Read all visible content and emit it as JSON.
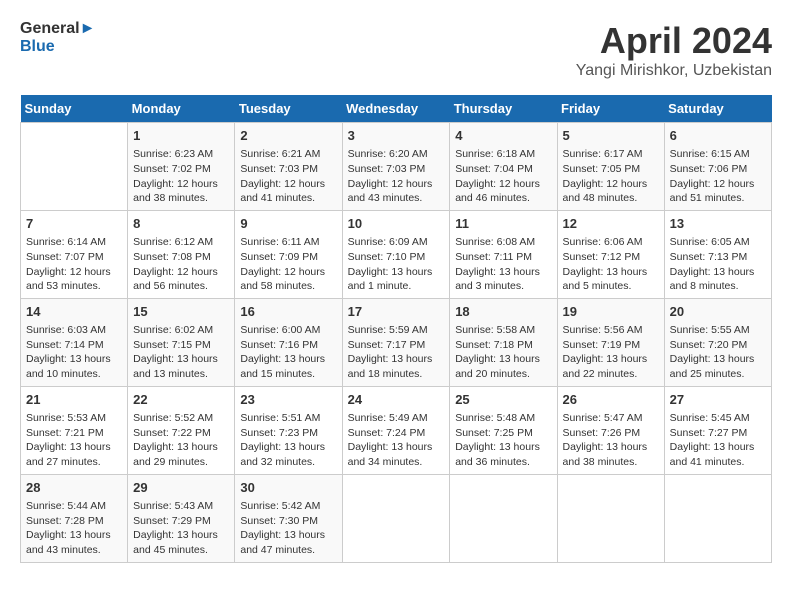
{
  "header": {
    "logo_line1": "General",
    "logo_line2": "Blue",
    "title": "April 2024",
    "subtitle": "Yangi Mirishkor, Uzbekistan"
  },
  "weekdays": [
    "Sunday",
    "Monday",
    "Tuesday",
    "Wednesday",
    "Thursday",
    "Friday",
    "Saturday"
  ],
  "weeks": [
    [
      {
        "day": "",
        "info": ""
      },
      {
        "day": "1",
        "info": "Sunrise: 6:23 AM\nSunset: 7:02 PM\nDaylight: 12 hours\nand 38 minutes."
      },
      {
        "day": "2",
        "info": "Sunrise: 6:21 AM\nSunset: 7:03 PM\nDaylight: 12 hours\nand 41 minutes."
      },
      {
        "day": "3",
        "info": "Sunrise: 6:20 AM\nSunset: 7:03 PM\nDaylight: 12 hours\nand 43 minutes."
      },
      {
        "day": "4",
        "info": "Sunrise: 6:18 AM\nSunset: 7:04 PM\nDaylight: 12 hours\nand 46 minutes."
      },
      {
        "day": "5",
        "info": "Sunrise: 6:17 AM\nSunset: 7:05 PM\nDaylight: 12 hours\nand 48 minutes."
      },
      {
        "day": "6",
        "info": "Sunrise: 6:15 AM\nSunset: 7:06 PM\nDaylight: 12 hours\nand 51 minutes."
      }
    ],
    [
      {
        "day": "7",
        "info": "Sunrise: 6:14 AM\nSunset: 7:07 PM\nDaylight: 12 hours\nand 53 minutes."
      },
      {
        "day": "8",
        "info": "Sunrise: 6:12 AM\nSunset: 7:08 PM\nDaylight: 12 hours\nand 56 minutes."
      },
      {
        "day": "9",
        "info": "Sunrise: 6:11 AM\nSunset: 7:09 PM\nDaylight: 12 hours\nand 58 minutes."
      },
      {
        "day": "10",
        "info": "Sunrise: 6:09 AM\nSunset: 7:10 PM\nDaylight: 13 hours\nand 1 minute."
      },
      {
        "day": "11",
        "info": "Sunrise: 6:08 AM\nSunset: 7:11 PM\nDaylight: 13 hours\nand 3 minutes."
      },
      {
        "day": "12",
        "info": "Sunrise: 6:06 AM\nSunset: 7:12 PM\nDaylight: 13 hours\nand 5 minutes."
      },
      {
        "day": "13",
        "info": "Sunrise: 6:05 AM\nSunset: 7:13 PM\nDaylight: 13 hours\nand 8 minutes."
      }
    ],
    [
      {
        "day": "14",
        "info": "Sunrise: 6:03 AM\nSunset: 7:14 PM\nDaylight: 13 hours\nand 10 minutes."
      },
      {
        "day": "15",
        "info": "Sunrise: 6:02 AM\nSunset: 7:15 PM\nDaylight: 13 hours\nand 13 minutes."
      },
      {
        "day": "16",
        "info": "Sunrise: 6:00 AM\nSunset: 7:16 PM\nDaylight: 13 hours\nand 15 minutes."
      },
      {
        "day": "17",
        "info": "Sunrise: 5:59 AM\nSunset: 7:17 PM\nDaylight: 13 hours\nand 18 minutes."
      },
      {
        "day": "18",
        "info": "Sunrise: 5:58 AM\nSunset: 7:18 PM\nDaylight: 13 hours\nand 20 minutes."
      },
      {
        "day": "19",
        "info": "Sunrise: 5:56 AM\nSunset: 7:19 PM\nDaylight: 13 hours\nand 22 minutes."
      },
      {
        "day": "20",
        "info": "Sunrise: 5:55 AM\nSunset: 7:20 PM\nDaylight: 13 hours\nand 25 minutes."
      }
    ],
    [
      {
        "day": "21",
        "info": "Sunrise: 5:53 AM\nSunset: 7:21 PM\nDaylight: 13 hours\nand 27 minutes."
      },
      {
        "day": "22",
        "info": "Sunrise: 5:52 AM\nSunset: 7:22 PM\nDaylight: 13 hours\nand 29 minutes."
      },
      {
        "day": "23",
        "info": "Sunrise: 5:51 AM\nSunset: 7:23 PM\nDaylight: 13 hours\nand 32 minutes."
      },
      {
        "day": "24",
        "info": "Sunrise: 5:49 AM\nSunset: 7:24 PM\nDaylight: 13 hours\nand 34 minutes."
      },
      {
        "day": "25",
        "info": "Sunrise: 5:48 AM\nSunset: 7:25 PM\nDaylight: 13 hours\nand 36 minutes."
      },
      {
        "day": "26",
        "info": "Sunrise: 5:47 AM\nSunset: 7:26 PM\nDaylight: 13 hours\nand 38 minutes."
      },
      {
        "day": "27",
        "info": "Sunrise: 5:45 AM\nSunset: 7:27 PM\nDaylight: 13 hours\nand 41 minutes."
      }
    ],
    [
      {
        "day": "28",
        "info": "Sunrise: 5:44 AM\nSunset: 7:28 PM\nDaylight: 13 hours\nand 43 minutes."
      },
      {
        "day": "29",
        "info": "Sunrise: 5:43 AM\nSunset: 7:29 PM\nDaylight: 13 hours\nand 45 minutes."
      },
      {
        "day": "30",
        "info": "Sunrise: 5:42 AM\nSunset: 7:30 PM\nDaylight: 13 hours\nand 47 minutes."
      },
      {
        "day": "",
        "info": ""
      },
      {
        "day": "",
        "info": ""
      },
      {
        "day": "",
        "info": ""
      },
      {
        "day": "",
        "info": ""
      }
    ]
  ]
}
